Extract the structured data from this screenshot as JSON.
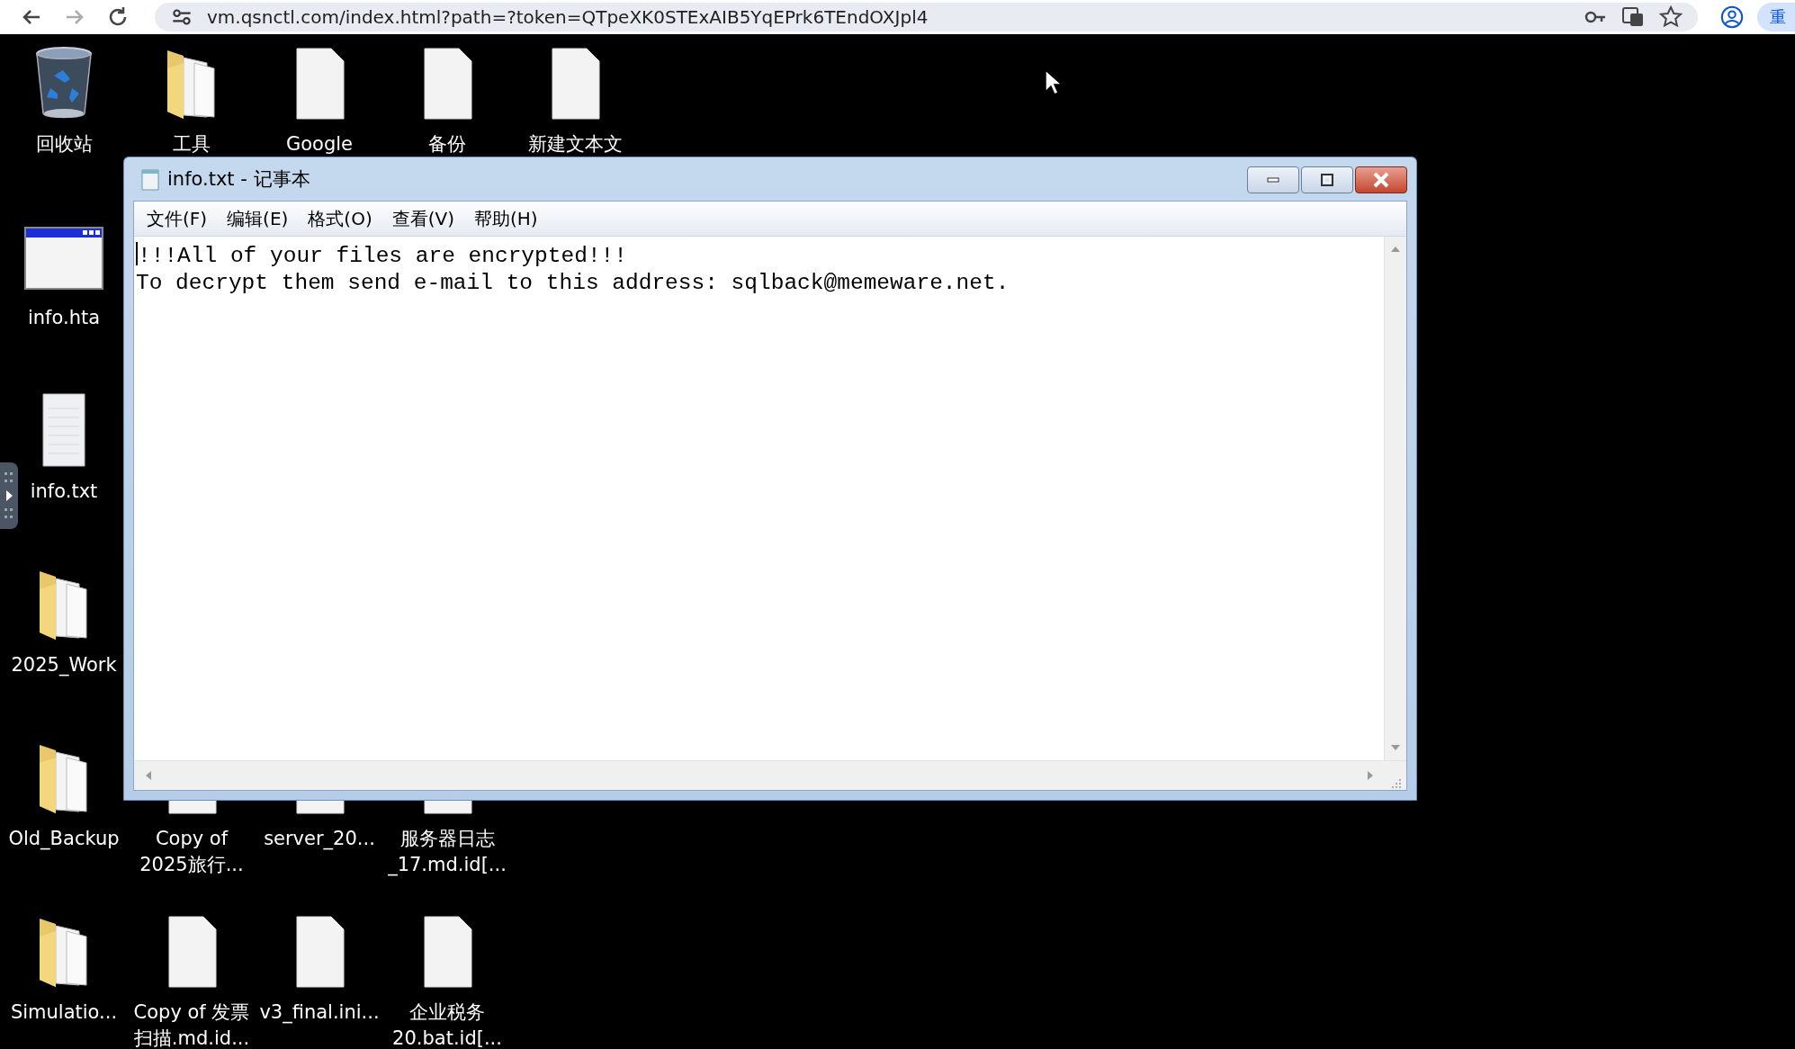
{
  "browser": {
    "url": "vm.qsnctl.com/index.html?path=?token=QTpeXK0STExAIB5YqEPrk6TEndOXJpl4",
    "action_button": "重"
  },
  "desktop": {
    "rows": [
      [
        {
          "kind": "recycle_bin",
          "label": "回收站"
        },
        {
          "kind": "folder",
          "label": "工具"
        },
        {
          "kind": "file",
          "label": "Google"
        },
        {
          "kind": "file",
          "label": "备份"
        },
        {
          "kind": "file",
          "label": "新建文本文"
        }
      ],
      [
        {
          "kind": "hta",
          "label": "info.hta"
        }
      ],
      [
        {
          "kind": "text",
          "label": "info.txt"
        }
      ],
      [
        {
          "kind": "folder",
          "label": "2025_Work"
        }
      ],
      [
        {
          "kind": "folder",
          "label": "Old_Backup"
        },
        {
          "kind": "file",
          "label": "Copy of\n2025旅行..."
        },
        {
          "kind": "file",
          "label": "server_20..."
        },
        {
          "kind": "file",
          "label": "服务器日志\n_17.md.id[..."
        }
      ],
      [
        {
          "kind": "folder",
          "label": "Simulatio..."
        },
        {
          "kind": "file",
          "label": "Copy of 发票扫描.md.id..."
        },
        {
          "kind": "file",
          "label": "v3_final.ini..."
        },
        {
          "kind": "file",
          "label": "企业税务\n20.bat.id[..."
        }
      ]
    ]
  },
  "notepad": {
    "title": "info.txt - 记事本",
    "menu": [
      "文件(F)",
      "编辑(E)",
      "格式(O)",
      "查看(V)",
      "帮助(H)"
    ],
    "caret": true,
    "lines": [
      "!!!All of your files are encrypted!!!",
      "To decrypt them send e-mail to this address: sqlback@memeware.net."
    ]
  }
}
